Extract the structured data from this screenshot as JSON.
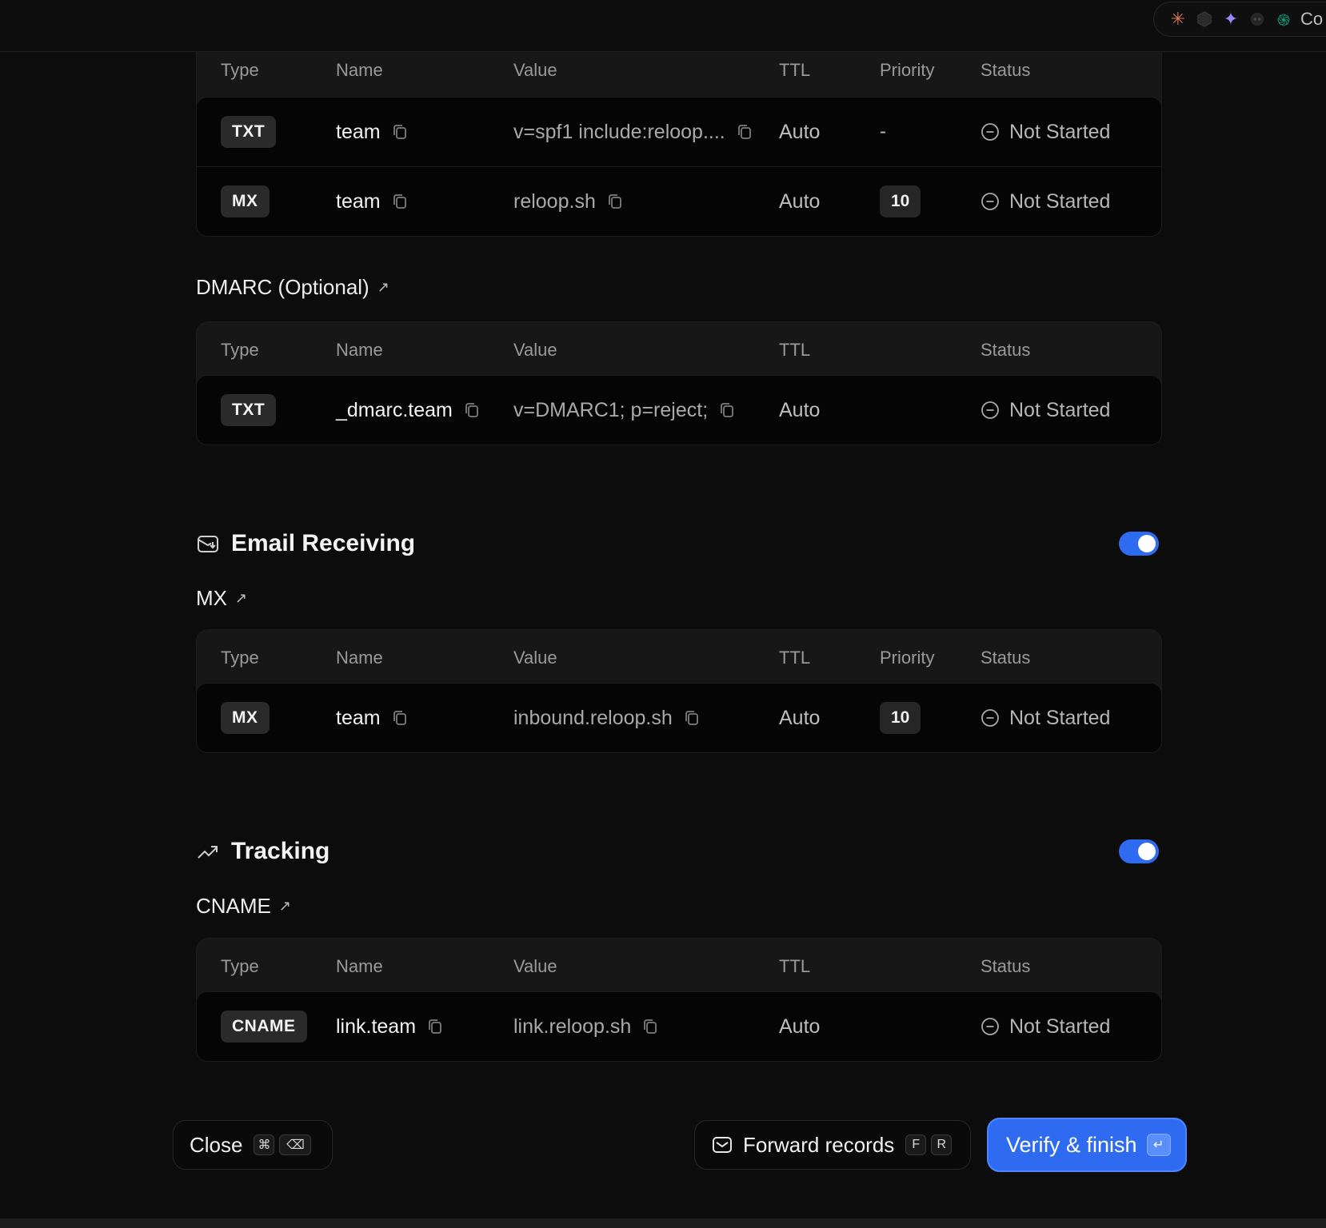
{
  "topbar": {
    "ai_icons": [
      "claude-icon",
      "perplexity-icon",
      "gemini-icon",
      "copilot-icon",
      "chatgpt-icon"
    ],
    "ai_label": "Co"
  },
  "columns": {
    "type": "Type",
    "name": "Name",
    "value": "Value",
    "ttl": "TTL",
    "priority": "Priority",
    "status": "Status"
  },
  "spf": {
    "rows": [
      {
        "type": "TXT",
        "name": "team",
        "value": "v=spf1 include:reloop....",
        "ttl": "Auto",
        "priority": "-",
        "status": "Not Started"
      },
      {
        "type": "MX",
        "name": "team",
        "value": "reloop.sh",
        "ttl": "Auto",
        "priority": "10",
        "status": "Not Started"
      }
    ]
  },
  "dmarc": {
    "title": "DMARC (Optional)",
    "rows": [
      {
        "type": "TXT",
        "name": "_dmarc.team",
        "value": "v=DMARC1; p=reject;",
        "ttl": "Auto",
        "status": "Not Started"
      }
    ]
  },
  "receiving": {
    "title": "Email Receiving",
    "enabled": true,
    "subtitle": "MX",
    "rows": [
      {
        "type": "MX",
        "name": "team",
        "value": "inbound.reloop.sh",
        "ttl": "Auto",
        "priority": "10",
        "status": "Not Started"
      }
    ]
  },
  "tracking": {
    "title": "Tracking",
    "enabled": true,
    "subtitle": "CNAME",
    "rows": [
      {
        "type": "CNAME",
        "name": "link.team",
        "value": "link.reloop.sh",
        "ttl": "Auto",
        "status": "Not Started"
      }
    ]
  },
  "footer": {
    "close_label": "Close",
    "close_keys": [
      "⌘",
      "⌫"
    ],
    "forward_label": "Forward records",
    "forward_keys": [
      "F",
      "R"
    ],
    "verify_label": "Verify & finish",
    "verify_key": "↵"
  },
  "colors": {
    "accent": "#2f6bf0",
    "background": "#0c0c0c",
    "panel": "#171717"
  }
}
